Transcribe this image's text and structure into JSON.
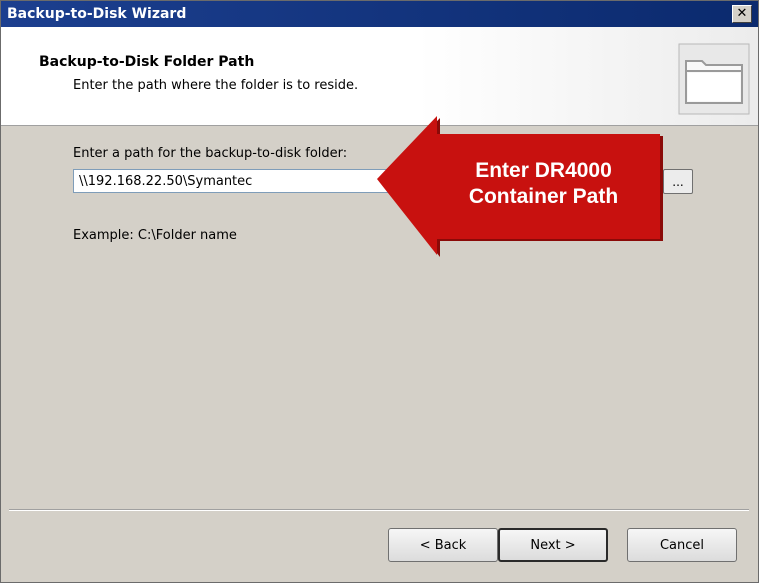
{
  "window": {
    "title": "Backup-to-Disk Wizard",
    "close_label": "✕"
  },
  "header": {
    "title": "Backup-to-Disk Folder Path",
    "subtitle": "Enter the path where the folder is to reside."
  },
  "form": {
    "path_label": "Enter a path for the backup-to-disk folder:",
    "path_value": "\\\\192.168.22.50\\Symantec",
    "browse_label": "...",
    "example": "Example: C:\\Folder name"
  },
  "annotation": {
    "line1": "Enter DR4000",
    "line2": "Container Path",
    "color": "#c8110f"
  },
  "buttons": {
    "back": "< Back",
    "next": "Next >",
    "cancel": "Cancel"
  }
}
